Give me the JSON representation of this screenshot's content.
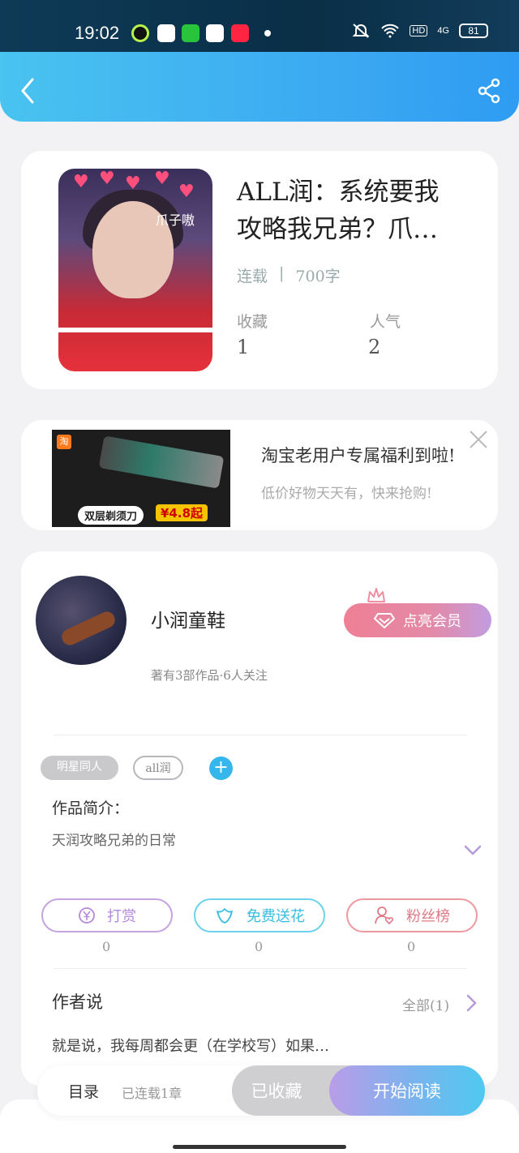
{
  "status_bar": {
    "time": "19:02",
    "network": "4G",
    "hd": "HD",
    "battery": "81"
  },
  "book": {
    "title_line1": "ALL润：系统要我",
    "title_line2": "攻略我兄弟？爪…",
    "status": "连载",
    "separator": "|",
    "word_count": "700字",
    "favorites_label": "收藏",
    "favorites_value": "1",
    "popularity_label": "人气",
    "popularity_value": "2",
    "cover_text": "爪子嗷"
  },
  "ad": {
    "title": "淘宝老用户专属福利到啦!",
    "subtitle": "低价好物天天有，快来抢购!",
    "image_caption": "双层剃须刀",
    "image_price": "¥4.8起",
    "store_badge": "淘"
  },
  "author": {
    "name": "小润童鞋",
    "meta": "著有3部作品·6人关注",
    "vip_label": "点亮会员",
    "tags": [
      "明星同人",
      "all润"
    ],
    "add_tag": "+",
    "intro_label": "作品简介：",
    "intro_text": "天润攻略兄弟的日常",
    "actions": [
      {
        "label": "打赏",
        "count": "0"
      },
      {
        "label": "免费送花",
        "count": "0"
      },
      {
        "label": "粉丝榜",
        "count": "0"
      }
    ],
    "say_label": "作者说",
    "say_all": "全部(1)",
    "say_text": "就是说，我每周都会更（在学校写）如果…"
  },
  "bottom": {
    "toc_label": "目录",
    "toc_count": "已连载1章",
    "fav_label": "已收藏",
    "read_label": "开始阅读"
  },
  "colors": {
    "header": "#3aa7f2",
    "accent_blue": "#35b7ec",
    "vip_pink": "#ef7f95",
    "read_gradient_end": "#4ec9f0"
  }
}
